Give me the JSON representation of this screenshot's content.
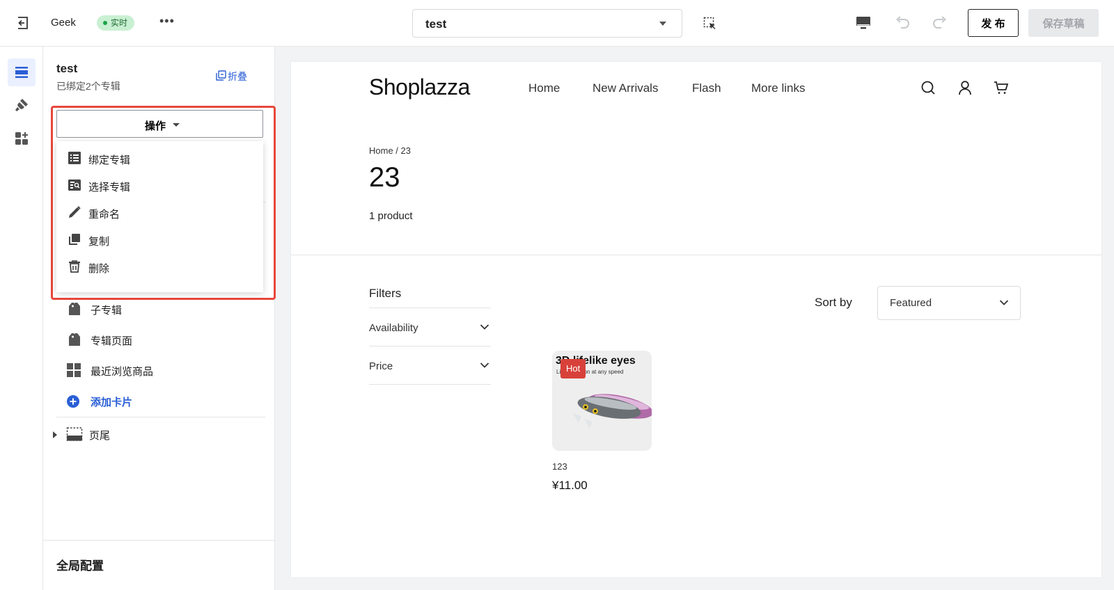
{
  "topbar": {
    "store_name": "Geek",
    "live_badge": "实时",
    "more": "•••",
    "theme_select": "test",
    "publish": "发 布",
    "save_draft": "保存草稿"
  },
  "panel": {
    "title": "test",
    "subtitle": "已绑定2个专辑",
    "collapse": "折叠",
    "operations_button": "操作",
    "menu": [
      "绑定专辑",
      "选择专辑",
      "重命名",
      "复制",
      "删除"
    ],
    "sections": {
      "sub_collection": "子专辑",
      "collection_page": "专辑页面",
      "recently_viewed": "最近浏览商品",
      "add_card": "添加卡片",
      "footer": "页尾"
    },
    "global_config": "全局配置"
  },
  "preview": {
    "logo": "Shoplazza",
    "nav": [
      "Home",
      "New Arrivals",
      "Flash",
      "More links"
    ],
    "breadcrumb": "Home  /  23",
    "title": "23",
    "product_count": "1 product",
    "filters_title": "Filters",
    "filters": [
      "Availability",
      "Price"
    ],
    "sort_label": "Sort by",
    "sort_value": "Featured",
    "product": {
      "badge": "Hot",
      "image_headline": "3D lifelike eyes",
      "image_tagline": "Lifelike action at any speed",
      "name": "123",
      "price": "¥11.00"
    }
  },
  "colors": {
    "accent": "#2a5fd6",
    "live_badge_bg": "#c9f0d2",
    "highlight_border": "#e8473c",
    "hot_badge": "#d8413a"
  },
  "icons": [
    "exit-icon",
    "element-picker-icon",
    "desktop-icon",
    "undo-icon",
    "redo-icon",
    "sections-icon",
    "theme-settings-icon",
    "apps-icon",
    "collapse-icon",
    "list-icon",
    "search-list-icon",
    "pencil-icon",
    "copy-icon",
    "trash-icon",
    "tag-icon",
    "grid-icon",
    "add-circle-icon",
    "footer-icon",
    "search-icon",
    "account-icon",
    "cart-icon",
    "chevron-down-icon"
  ]
}
